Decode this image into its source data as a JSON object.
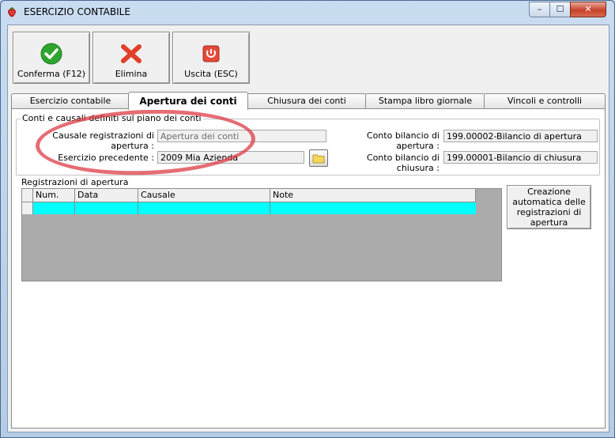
{
  "window": {
    "title": "ESERCIZIO CONTABILE",
    "min_symbol": "–",
    "max_symbol": "☐",
    "close_symbol": "✕"
  },
  "toolbar": {
    "confirm_label": "Conferma (F12)",
    "delete_label": "Elimina",
    "exit_label": "Uscita (ESC)"
  },
  "tabs": [
    {
      "label": "Esercizio contabile"
    },
    {
      "label": "Apertura dei conti"
    },
    {
      "label": "Chiusura dei conti"
    },
    {
      "label": "Stampa libro giornale"
    },
    {
      "label": "Vincoli e controlli"
    }
  ],
  "group": {
    "title": "Conti e causali definiti sul piano dei conti",
    "causale_label": "Causale registrazioni di apertura :",
    "causale_value": "Apertura dei conti",
    "esercizio_label": "Esercizio precedente :",
    "esercizio_value": "2009 Mia Azienda",
    "conto_apertura_label": "Conto bilancio di apertura :",
    "conto_apertura_value": "199.00002-Bilancio di apertura",
    "conto_chiusura_label": "Conto bilancio di chiusura :",
    "conto_chiusura_value": "199.00001-Bilancio di chiusura"
  },
  "registrazioni": {
    "title": "Registrazioni di apertura",
    "columns": [
      "Num.",
      "Data",
      "Causale",
      "Note"
    ]
  },
  "auto_button_label": "Creazione automatica delle registrazioni di apertura",
  "colors": {
    "row_highlight": "#00ffff",
    "annotation": "#dc3c46"
  }
}
